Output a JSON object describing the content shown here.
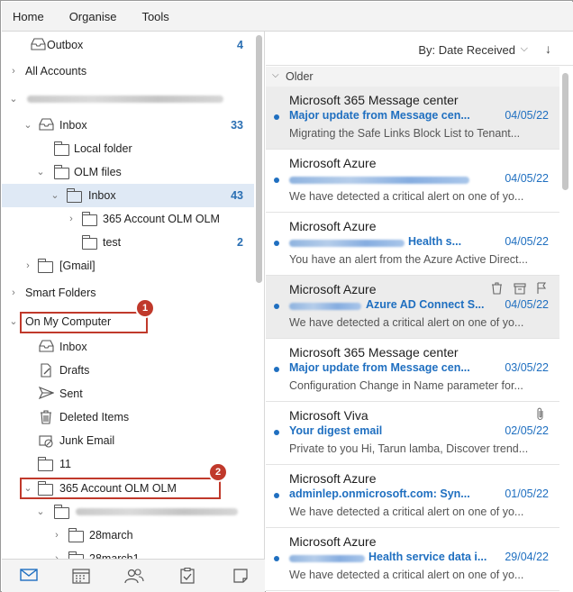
{
  "menu": [
    "Home",
    "Organise",
    "Tools"
  ],
  "folders": {
    "outbox": {
      "label": "Outbox",
      "count": "4"
    },
    "all_accounts": "All Accounts",
    "inbox": {
      "label": "Inbox",
      "count": "33"
    },
    "local_folder": "Local folder",
    "olm_files": "OLM files",
    "olm_inbox": {
      "label": "Inbox",
      "count": "43"
    },
    "acct_olm": "365 Account OLM OLM",
    "test": {
      "label": "test",
      "count": "2"
    },
    "gmail": "[Gmail]",
    "smart_folders": "Smart Folders",
    "on_my_computer": "On My Computer",
    "local_inbox": "Inbox",
    "drafts": "Drafts",
    "sent": "Sent",
    "deleted": "Deleted Items",
    "junk": "Junk Email",
    "eleven": "11",
    "acct2": "365 Account OLM OLM",
    "march28": "28march",
    "march28_1": "28march1"
  },
  "callouts": [
    "1",
    "2"
  ],
  "sort": {
    "label": "By: Date Received",
    "chevron": "⌵",
    "arrow": "↓"
  },
  "group": "Older",
  "messages": [
    {
      "from": "Microsoft 365 Message center",
      "subject": "Major update from Message cen...",
      "date": "04/05/22",
      "preview": "Migrating the Safe Links Block List to Tenant..."
    },
    {
      "from": "Microsoft Azure",
      "subject": "",
      "date": "04/05/22",
      "preview": "We have detected a critical alert on one of yo..."
    },
    {
      "from": "Microsoft Azure",
      "subject": "Health s...",
      "date": "04/05/22",
      "preview": "You have an alert from the Azure Active Direct..."
    },
    {
      "from": "Microsoft Azure",
      "subject": "Azure AD Connect S...",
      "date": "04/05/22",
      "preview": "We have detected a critical alert on one of yo..."
    },
    {
      "from": "Microsoft 365 Message center",
      "subject": "Major update from Message cen...",
      "date": "03/05/22",
      "preview": "Configuration Change in Name parameter for..."
    },
    {
      "from": "Microsoft Viva",
      "subject": "Your digest email",
      "date": "02/05/22",
      "preview": "Private to you Hi, Tarun lamba, Discover trend..."
    },
    {
      "from": "Microsoft Azure",
      "subject": "adminlep.onmicrosoft.com: Syn...",
      "date": "01/05/22",
      "preview": "We have detected a critical alert on one of yo..."
    },
    {
      "from": "Microsoft Azure",
      "subject": "Health service data i...",
      "date": "29/04/22",
      "preview": "We have detected a critical alert on one of yo..."
    }
  ]
}
